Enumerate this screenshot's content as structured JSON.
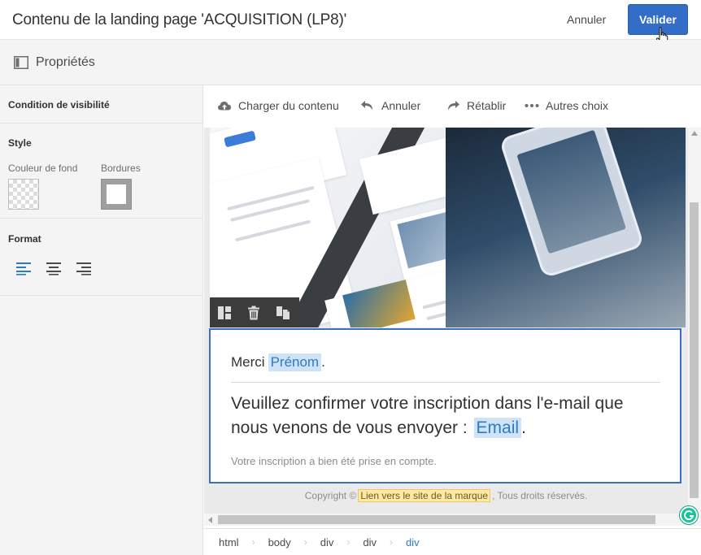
{
  "header": {
    "title": "Contenu de la landing page 'ACQUISITION (LP8)'",
    "cancel_label": "Annuler",
    "validate_label": "Valider"
  },
  "properties_bar": {
    "label": "Propriétés"
  },
  "sidebar": {
    "visibility_heading": "Condition de visibilité",
    "style_heading": "Style",
    "background_color_label": "Couleur de fond",
    "borders_label": "Bordures",
    "format_heading": "Format",
    "alignments": [
      "align-left-icon",
      "align-center-icon",
      "align-right-icon"
    ],
    "active_alignment": "align-left-icon"
  },
  "toolbar": {
    "load_content": "Charger du contenu",
    "undo": "Annuler",
    "redo": "Rétablir",
    "more": "Autres choix"
  },
  "content": {
    "thanks_prefix": "Merci",
    "firstname_field": "Prénom",
    "thanks_suffix": ".",
    "confirm_text": "Veuillez confirmer votre inscription dans l'e-mail que nous venons de vous envoyer :",
    "email_field": "Email",
    "confirm_suffix": ".",
    "done_text": "Votre inscription a bien été prise en compte."
  },
  "footer": {
    "copyright": "Copyright ©",
    "brand_link": "Lien vers le site de la marque",
    "rights": ", Tous droits réservés."
  },
  "breadcrumb": [
    "html",
    "body",
    "div",
    "div",
    "div"
  ],
  "colors": {
    "accent": "#326ec8",
    "selection_border": "#3c70bf",
    "field_tag_bg": "#cfe3f7",
    "link_highlight": "#fde8a6"
  }
}
